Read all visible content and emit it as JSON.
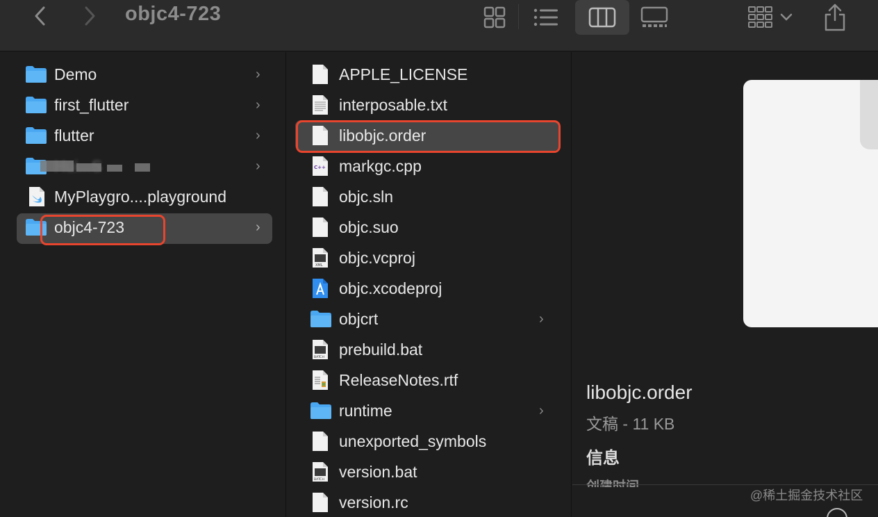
{
  "window": {
    "title": "objc4-723"
  },
  "toolbar": {
    "back_icon": "chevron-left-icon",
    "forward_icon": "chevron-right-icon",
    "views": [
      "icon-view",
      "list-view",
      "column-view",
      "gallery-view"
    ],
    "active_view": "column-view",
    "group_icon": "group-grid-icon",
    "share_icon": "share-icon"
  },
  "sidebar_column": {
    "items": [
      {
        "name": "Demo",
        "kind": "folder",
        "has_children": true
      },
      {
        "name": "first_flutter",
        "kind": "folder",
        "has_children": true
      },
      {
        "name": "flutter",
        "kind": "folder",
        "has_children": true
      },
      {
        "name": "Hui...S",
        "kind": "folder",
        "has_children": true,
        "obscured": true
      },
      {
        "name": "MyPlaygro....playground",
        "kind": "swift-playground",
        "has_children": false
      },
      {
        "name": "objc4-723",
        "kind": "folder",
        "has_children": true,
        "selected": true
      }
    ]
  },
  "files_column": {
    "items": [
      {
        "name": "APPLE_LICENSE",
        "kind": "document"
      },
      {
        "name": "interposable.txt",
        "kind": "text"
      },
      {
        "name": "libobjc.order",
        "kind": "document",
        "selected": true
      },
      {
        "name": "markgc.cpp",
        "kind": "cpp",
        "badge": "C++"
      },
      {
        "name": "objc.sln",
        "kind": "document"
      },
      {
        "name": "objc.suo",
        "kind": "document"
      },
      {
        "name": "objc.vcproj",
        "kind": "xml",
        "badge": "XML"
      },
      {
        "name": "objc.xcodeproj",
        "kind": "xcodeproj"
      },
      {
        "name": "objcrt",
        "kind": "folder",
        "has_children": true
      },
      {
        "name": "prebuild.bat",
        "kind": "batch",
        "badge": "BATCH"
      },
      {
        "name": "ReleaseNotes.rtf",
        "kind": "rtf"
      },
      {
        "name": "runtime",
        "kind": "folder",
        "has_children": true
      },
      {
        "name": "unexported_symbols",
        "kind": "document"
      },
      {
        "name": "version.bat",
        "kind": "batch",
        "badge": "BATCH"
      },
      {
        "name": "version.rc",
        "kind": "document"
      }
    ]
  },
  "preview": {
    "name": "libobjc.order",
    "meta": "文稿 - 11 KB",
    "info_heading": "信息",
    "created_label": "创建时间",
    "watermark": "@稀土掘金技术社区"
  },
  "colors": {
    "background": "#1e1e1e",
    "toolbar": "#2b2b2b",
    "selection": "#464646",
    "highlight": "#e8452e",
    "folder": "#4aa8f2"
  }
}
